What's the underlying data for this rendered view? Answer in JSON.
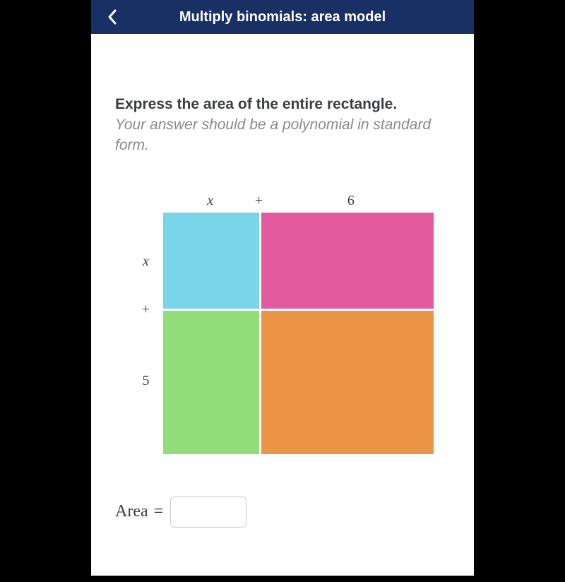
{
  "header": {
    "title": "Multiply binomials: area model"
  },
  "question": {
    "prompt": "Express the area of the entire rectangle.",
    "sub": "Your answer should be a polynomial in standard form."
  },
  "diagram": {
    "col1": "x",
    "colPlus": "+",
    "col2": "6",
    "row1": "x",
    "rowPlus": "+",
    "row2": "5"
  },
  "answer": {
    "label": "Area",
    "equals": "=",
    "value": ""
  }
}
